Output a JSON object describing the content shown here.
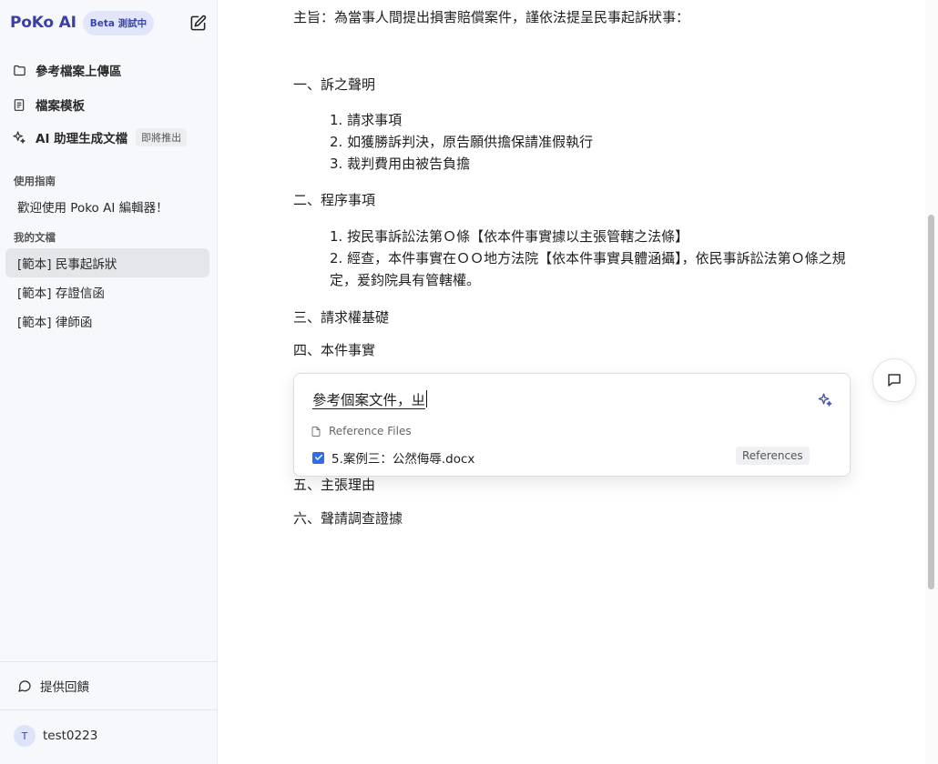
{
  "brand": {
    "name": "PoKo AI",
    "badge": "Beta 測試中"
  },
  "nav": {
    "upload": "參考檔案上傳區",
    "templates": "檔案模板",
    "ai_generate": "AI 助理生成文檔",
    "ai_badge": "即將推出"
  },
  "guide": {
    "heading": "使用指南",
    "welcome": "歡迎使用 Poko AI 編輯器！"
  },
  "my_docs": {
    "heading": "我的文檔",
    "items": [
      "[範本] 民事起訴狀",
      "[範本] 存證信函",
      "[範本] 律師函"
    ]
  },
  "footer": {
    "feedback": "提供回饋",
    "avatar_initial": "T",
    "username": "test0223"
  },
  "document": {
    "intro": "主旨：為當事人間提出損害賠償案件，謹依法提呈民事起訴狀事：",
    "s1": "一、訴之聲明",
    "s1_items": [
      "1. 請求事項",
      "2. 如獲勝訴判決，原告願供擔保請准假執行",
      "3. 裁判費用由被告負擔"
    ],
    "s2": "二、程序事項",
    "s2_items": [
      "1. 按民事訴訟法第Ｏ條【依本件事實據以主張管轄之法條】",
      "2. 經查，本件事實在ＯＯ地方法院【依本件事實具體涵攝】，依民事訴訟法第Ｏ條之規定，爰鈞院具有管轄權。"
    ],
    "s3": "三、請求權基礎",
    "s4": "四、本件事實",
    "s5": "五、主張理由",
    "s6": "六、聲請調查證據"
  },
  "ai_popup": {
    "input_text": "參考個案文件，ㄓ",
    "ref_heading": "Reference Files",
    "ref_file": "5.案例三：公然侮辱.docx",
    "ref_tag": "References"
  },
  "colors": {
    "brand": "#3a3fa8",
    "accent": "#2f6ce5",
    "sidebar_bg": "#f7f8fb"
  }
}
